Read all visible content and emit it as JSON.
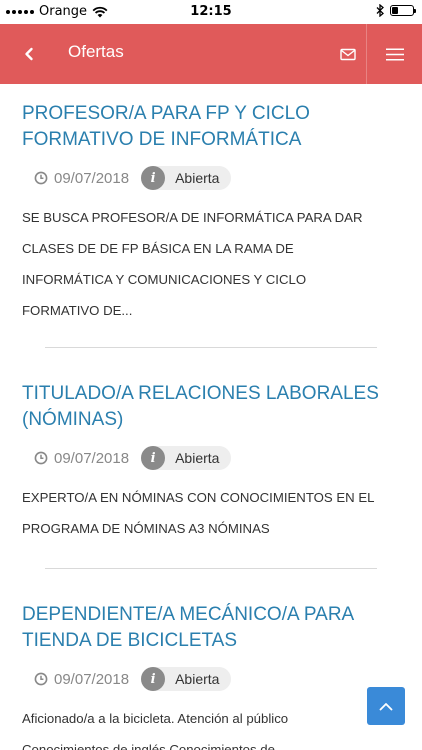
{
  "status_bar": {
    "carrier": "Orange",
    "time": "12:15",
    "battery_level": 0.3
  },
  "header": {
    "title": "Ofertas",
    "accent_color": "#e05a5a",
    "icons": [
      "chevron-left-icon",
      "mail-icon",
      "hamburger-menu-icon"
    ]
  },
  "offers": [
    {
      "title": "PROFESOR/A PARA FP Y CICLO FORMATIVO DE INFORMÁTICA",
      "date": "09/07/2018",
      "status": "Abierta",
      "description": "SE BUSCA PROFESOR/A DE INFORMÁTICA PARA DAR CLASES DE DE FP BÁSICA  EN LA RAMA DE INFORMÁTICA Y COMUNICACIONES Y CICLO FORMATIVO DE..."
    },
    {
      "title": "TITULADO/A RELACIONES LABORALES (NÓMINAS)",
      "date": "09/07/2018",
      "status": "Abierta",
      "description": "EXPERTO/A EN NÓMINAS CON CONOCIMIENTOS EN EL PROGRAMA DE NÓMINAS A3 NÓMINAS"
    },
    {
      "title": "DEPENDIENTE/A MECÁNICO/A PARA TIENDA DE BICICLETAS",
      "date": "09/07/2018",
      "status": "Abierta",
      "description": "Aficionado/a a la bicicleta. Atención al público Conocimientos de inglés Conocimientos de"
    }
  ],
  "colors": {
    "title": "#2a7fae",
    "scroll_button": "#3a8ad8"
  }
}
